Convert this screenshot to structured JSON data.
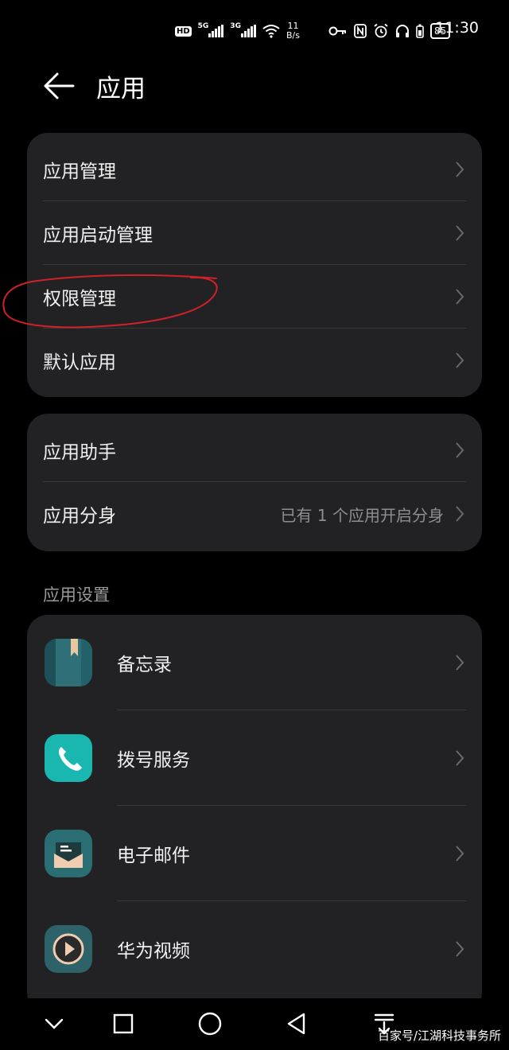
{
  "status_bar": {
    "hd_label": "HD",
    "sim1_tag": "5G",
    "sim2_tag": "3G",
    "speed_value": "11",
    "speed_unit": "B/s",
    "battery": "85",
    "time": "11:30"
  },
  "header": {
    "title": "应用"
  },
  "card1": {
    "items": [
      {
        "label": "应用管理"
      },
      {
        "label": "应用启动管理"
      },
      {
        "label": "权限管理"
      },
      {
        "label": "默认应用"
      }
    ]
  },
  "card2": {
    "items": [
      {
        "label": "应用助手",
        "value": ""
      },
      {
        "label": "应用分身",
        "value": "已有 1 个应用开启分身"
      }
    ]
  },
  "app_settings": {
    "title": "应用设置",
    "apps": [
      {
        "label": "备忘录",
        "icon": "notepad-icon"
      },
      {
        "label": "拨号服务",
        "icon": "phone-icon"
      },
      {
        "label": "电子邮件",
        "icon": "email-icon"
      },
      {
        "label": "华为视频",
        "icon": "video-play-icon"
      }
    ]
  },
  "watermark": "百家号/江湖科技事务所",
  "colors": {
    "background": "#000000",
    "card": "#222224",
    "annotation": "#d0202a",
    "secondary_text": "#8e8e8e"
  }
}
